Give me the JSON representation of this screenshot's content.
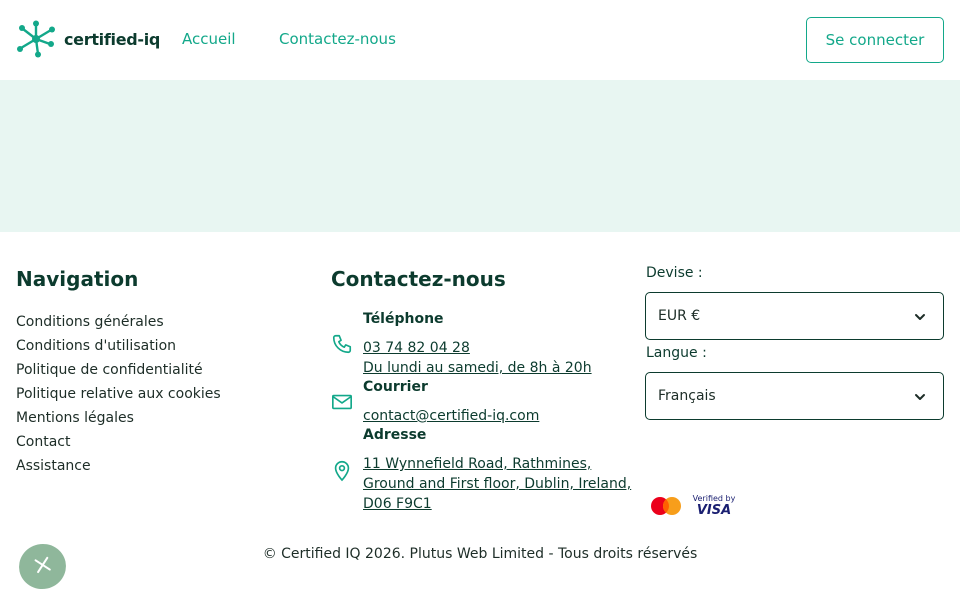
{
  "header": {
    "logo_text": "certified-iq",
    "nav": {
      "home": "Accueil",
      "contact": "Contactez-nous"
    },
    "login_button": "Se connecter"
  },
  "footer": {
    "navigation": {
      "title": "Navigation",
      "links": [
        "Conditions générales",
        "Conditions d'utilisation",
        "Politique de confidentialité",
        "Politique relative aux cookies",
        "Mentions légales",
        "Contact",
        "Assistance"
      ]
    },
    "contact": {
      "title": "Contactez-nous",
      "phone_label": "Téléphone",
      "phone_number": "03 74 82 04 28",
      "phone_hours": "Du lundi au samedi, de 8h à 20h",
      "mail_label": "Courrier",
      "mail_address": "contact@certified-iq.com",
      "address_label": "Adresse",
      "address_lines": [
        "11 Wynnefield Road, Rathmines,",
        "Ground and First floor, Dublin, Ireland,",
        "D06 F9C1"
      ]
    },
    "settings": {
      "currency_label": "Devise :",
      "currency_value": "EUR €",
      "language_label": "Langue :",
      "language_value": "Français"
    },
    "payments": {
      "visa_top": "Verified by",
      "visa_brand": "VISA"
    },
    "copyright": "© Certified IQ 2026. Plutus Web Limited - Tous droits réservés"
  },
  "colors": {
    "brand": "#13a88a",
    "dark": "#0c3b2e",
    "band": "#e8f6f2"
  },
  "icons": [
    "logo-icon",
    "phone-icon",
    "mail-icon",
    "location-pin-icon",
    "chevron-down-icon",
    "close-icon",
    "mastercard-icon",
    "visa-icon"
  ]
}
